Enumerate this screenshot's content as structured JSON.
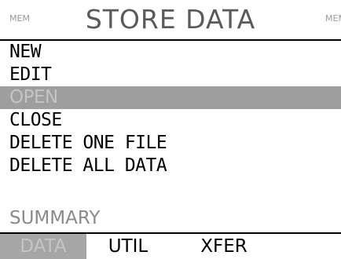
{
  "header": {
    "left_label": "MEM",
    "title": "STORE DATA",
    "right_label": "MEM"
  },
  "menu": {
    "items": [
      {
        "label": "NEW"
      },
      {
        "label": "EDIT"
      },
      {
        "label": "OPEN"
      },
      {
        "label": "CLOSE"
      },
      {
        "label": "DELETE ONE FILE"
      },
      {
        "label": "DELETE ALL DATA"
      },
      {
        "label": ""
      },
      {
        "label": "SUMMARY"
      }
    ]
  },
  "tabs": [
    {
      "label": "DATA"
    },
    {
      "label": "UTIL"
    },
    {
      "label": "XFER"
    }
  ]
}
